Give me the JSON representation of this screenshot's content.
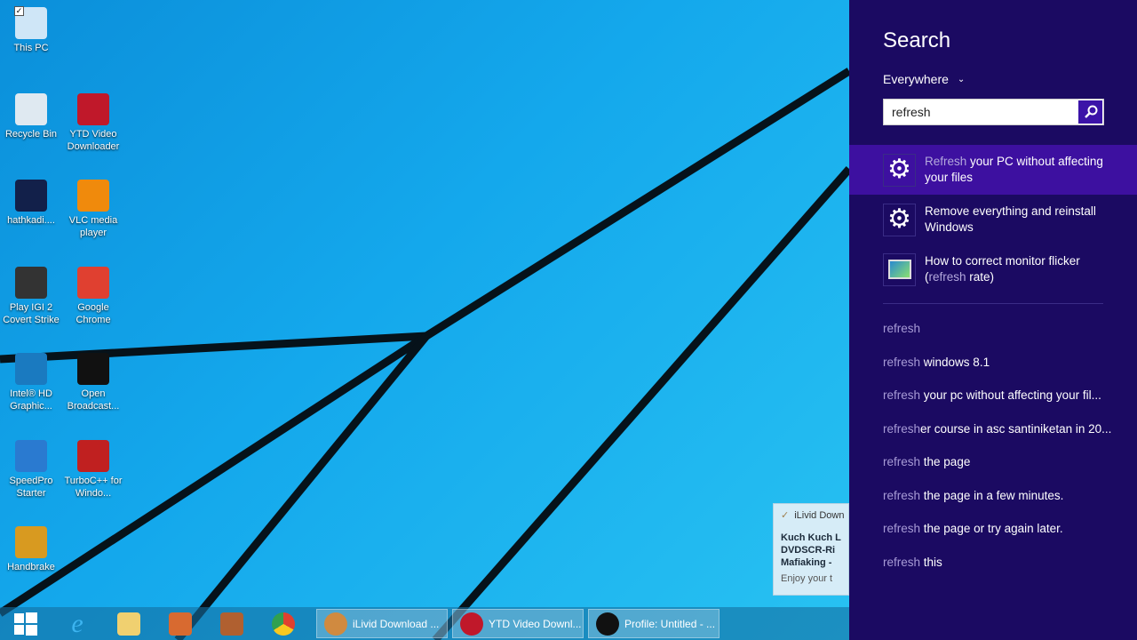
{
  "desktop": {
    "icons": [
      {
        "label": "This PC",
        "color": "#cfe6f7"
      },
      {
        "label": "Recycle Bin",
        "color": "#dfe9f1"
      },
      {
        "label": "YTD Video Downloader",
        "color": "#c0182a"
      },
      {
        "label": "hathkadi....",
        "color": "#12204a"
      },
      {
        "label": "VLC media player",
        "color": "#f08a0c"
      },
      {
        "label": "Play IGI 2 Covert Strike",
        "color": "#333"
      },
      {
        "label": "Google Chrome",
        "color": "#e04030"
      },
      {
        "label": "Intel® HD Graphic...",
        "color": "#1a7ac0"
      },
      {
        "label": "Open Broadcast...",
        "color": "#111"
      },
      {
        "label": "SpeedPro Starter",
        "color": "#2a7ad0"
      },
      {
        "label": "TurboC++ for Windo...",
        "color": "#c02020"
      },
      {
        "label": "Handbrake",
        "color": "#d89a20"
      }
    ]
  },
  "notification": {
    "app": "iLivid Down",
    "lines": [
      "Kuch Kuch L",
      "DVDSCR-Ri",
      "Mafiaking -"
    ],
    "footer": "Enjoy your t"
  },
  "taskbar": {
    "pinned": [
      "start-icon",
      "internet-explorer-icon",
      "file-explorer-icon",
      "app-icon",
      "media-icon",
      "chrome-icon"
    ],
    "windows": [
      {
        "label": "iLivid Download ...",
        "color": "#d08a40"
      },
      {
        "label": "YTD Video Downl...",
        "color": "#c0182a"
      },
      {
        "label": "Profile: Untitled - ...",
        "color": "#111"
      }
    ]
  },
  "search": {
    "title": "Search",
    "scope": "Everywhere",
    "query": "refresh",
    "results": [
      {
        "match": "Refresh",
        "rest": " your PC without affecting your files",
        "pre": ""
      },
      {
        "match": "",
        "rest": "Remove everything and reinstall Windows",
        "pre": ""
      },
      {
        "pre": "How to correct monitor flicker (",
        "match": "refresh",
        "rest": " rate)"
      }
    ],
    "suggestions": [
      {
        "match": "refresh",
        "rest": ""
      },
      {
        "match": "refresh",
        "rest": " windows 8.1"
      },
      {
        "match": "refresh",
        "rest": " your pc without affecting your fil..."
      },
      {
        "match": "refresh",
        "rest": "er course in asc santiniketan in 20..."
      },
      {
        "match": "refresh",
        "rest": " the page"
      },
      {
        "match": "refresh",
        "rest": " the page in a few minutes."
      },
      {
        "match": "refresh",
        "rest": " the page or try again later."
      },
      {
        "match": "refresh",
        "rest": " this"
      }
    ]
  },
  "colors": {
    "charm": "#1b0a62",
    "highlight": "#3d10a0"
  }
}
